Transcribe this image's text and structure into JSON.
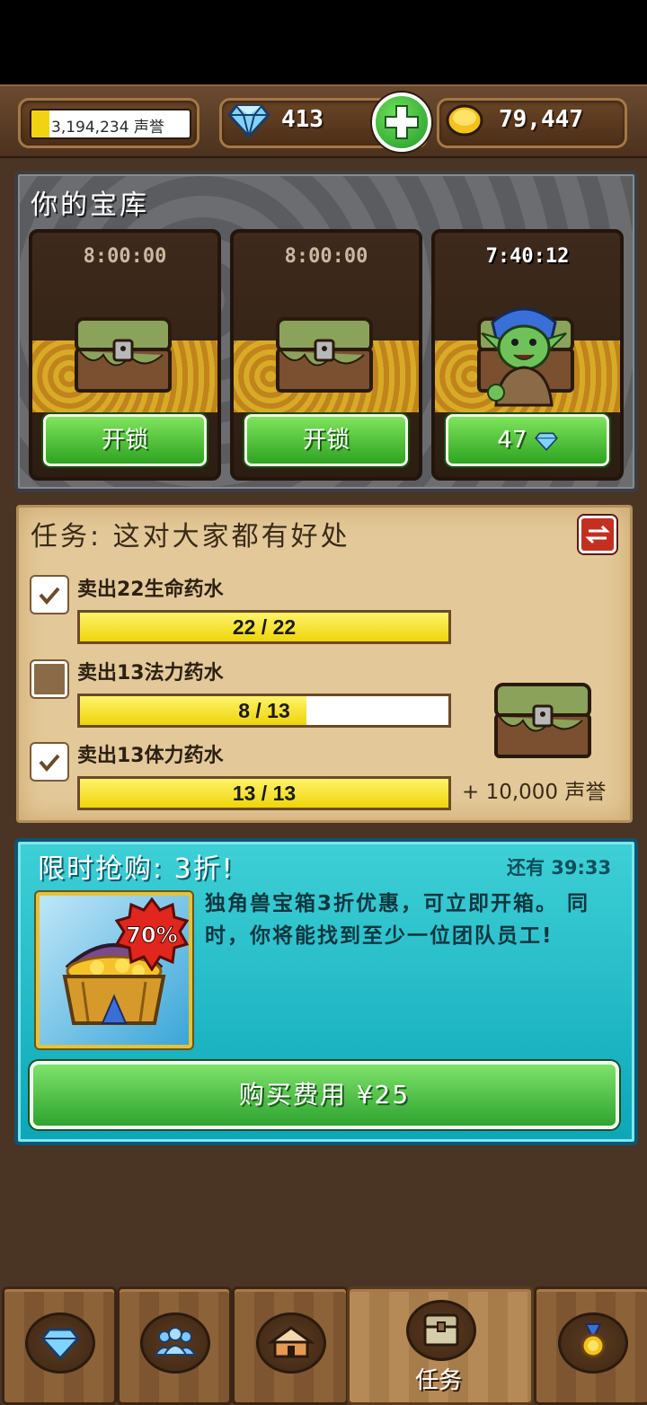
{
  "top_bar": {
    "fame_text": "3,194,234 声誉",
    "fame_fill_fraction": 0.12,
    "gems": "413",
    "gold": "79,447",
    "icons": [
      "diamond-icon",
      "plus-icon",
      "gold-coin-icon"
    ]
  },
  "vault": {
    "title": "你的宝库",
    "slots": [
      {
        "timer": "8:00:00",
        "button": "开锁"
      },
      {
        "timer": "8:00:00",
        "button": "开锁"
      },
      {
        "timer": "7:40:12",
        "button": "47"
      }
    ]
  },
  "mission": {
    "title": "任务: 这对大家都有好处",
    "tasks": [
      {
        "label": "卖出22生命药水",
        "progress": "22 / 22",
        "done": true,
        "fraction": 1.0
      },
      {
        "label": "卖出13法力药水",
        "progress": "8 / 13",
        "done": false,
        "fraction": 0.615
      },
      {
        "label": "卖出13体力药水",
        "progress": "13 / 13",
        "done": true,
        "fraction": 1.0
      }
    ],
    "reward": "+ 10,000 声誉"
  },
  "flash_sale": {
    "title": "限时抢购: 3折!",
    "timer": "还有 39:33",
    "badge": "70%",
    "description": "独角兽宝箱3折优惠，可立即开箱。 同时，你将能找到至少一位团队员工!",
    "buy_button": "购买费用 ¥25"
  },
  "bottom_nav": {
    "active_label": "任务",
    "items": [
      "diamond-icon",
      "team-icon",
      "house-icon",
      "chest-icon",
      "medal-icon"
    ]
  },
  "colors": {
    "wood": "#4a3424",
    "green_button": "#2ea321",
    "progress_yellow": "#eed50a",
    "sale_cyan": "#0da6b8"
  }
}
